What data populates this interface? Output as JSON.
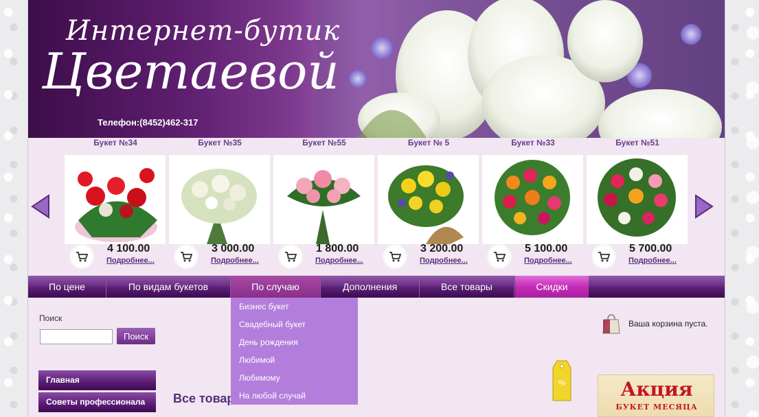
{
  "header": {
    "logo_line1": "Интернет-бутик",
    "logo_line2": "Цветаевой",
    "phone": "Телефон:(8452)462-317"
  },
  "carousel": {
    "items": [
      {
        "name": "Букет №34",
        "price": "4 100.00",
        "more": "Подробнее..."
      },
      {
        "name": "Букет №35",
        "price": "3 000.00",
        "more": "Подробнее..."
      },
      {
        "name": "Букет №55",
        "price": "1 800.00",
        "more": "Подробнее..."
      },
      {
        "name": "Букет № 5",
        "price": "3 200.00",
        "more": "Подробнее..."
      },
      {
        "name": "Букет №33",
        "price": "5 100.00",
        "more": "Подробнее..."
      },
      {
        "name": "Букет №51",
        "price": "5 700.00",
        "more": "Подробнее..."
      }
    ]
  },
  "nav": {
    "items": [
      "По цене",
      "По видам букетов",
      "По случаю",
      "Дополнения",
      "Все товары",
      "Скидки"
    ]
  },
  "dropdown": {
    "items": [
      "Бизнес букет",
      "Свадебный букет",
      "День рождения",
      "Любимой",
      "Любимому",
      "На любой случай"
    ]
  },
  "search": {
    "label": "Поиск",
    "button": "Поиск",
    "value": ""
  },
  "cart": {
    "status": "Ваша корзина пуста."
  },
  "sidebar": {
    "items": [
      "Главная",
      "Советы профессионала"
    ]
  },
  "main": {
    "title": "Все товар"
  },
  "promo": {
    "title": "Акция",
    "subtitle": "БУКЕТ МЕСЯЦА"
  },
  "colors": {
    "brand_purple": "#5a1f73",
    "accent_pink": "#c52cb7",
    "dropdown_bg": "#b37edb",
    "page_bg": "#f1e6f1"
  }
}
